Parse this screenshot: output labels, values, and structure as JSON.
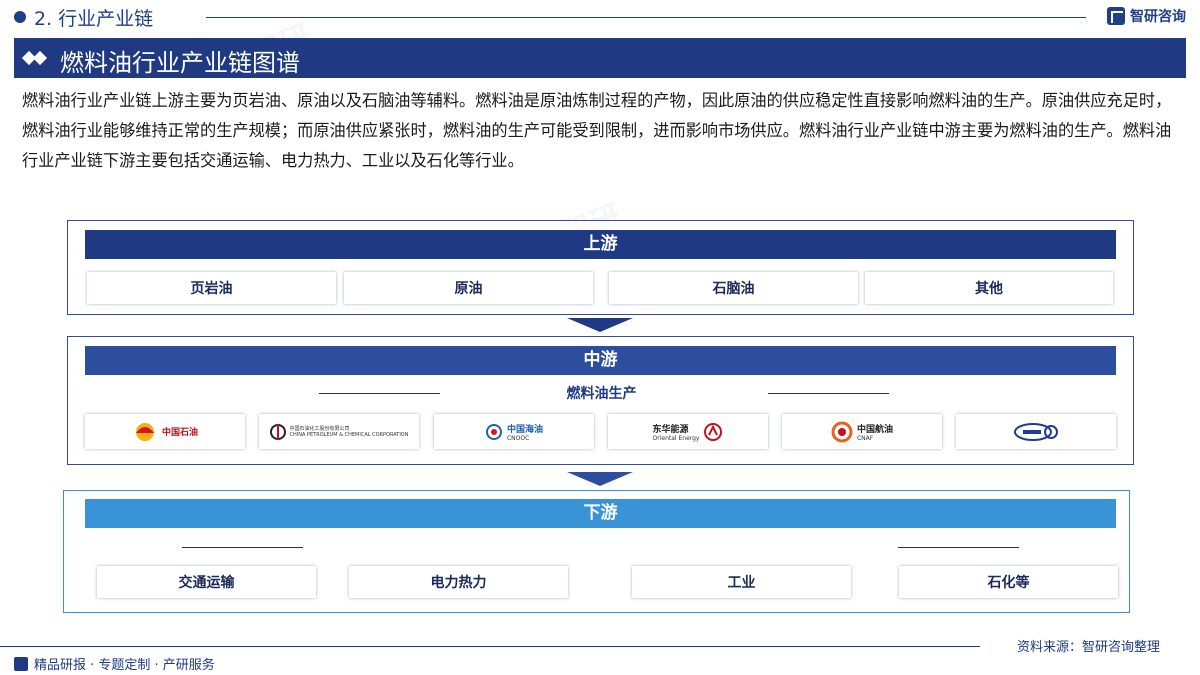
{
  "header": {
    "section_label": "2. 行业产业链",
    "brand_name": "智研咨询"
  },
  "title_bar": {
    "title": "燃料油行业产业链图谱"
  },
  "intro_text": "燃料油行业产业链上游主要为页岩油、原油以及石脑油等辅料。燃料油是原油炼制过程的产物，因此原油的供应稳定性直接影响燃料油的生产。原油供应充足时，燃料油行业能够维持正常的生产规模；而原油供应紧张时，燃料油的生产可能受到限制，进而影响市场供应。燃料油行业产业链中游主要为燃料油的生产。燃料油行业产业链下游主要包括交通运输、电力热力、工业以及石化等行业。",
  "upstream": {
    "label": "上游",
    "items": [
      "页岩油",
      "原油",
      "石脑油",
      "其他"
    ]
  },
  "midstream": {
    "label": "中游",
    "sub_label": "燃料油生产",
    "logos": [
      {
        "name": "中国石油"
      },
      {
        "name": "中国石油化工股份有限公司",
        "sub": "CHINA PETROLEUM & CHEMICAL CORPORATION"
      },
      {
        "name": "中国海油",
        "sub": "CNOOC"
      },
      {
        "name": "东华能源",
        "sub": "Oriental Energy"
      },
      {
        "name": "中国航油",
        "sub": "CNAF"
      },
      {
        "name": ""
      }
    ]
  },
  "downstream": {
    "label": "下游",
    "items": [
      "交通运输",
      "电力热力",
      "工业",
      "石化等"
    ]
  },
  "footer": {
    "source": "资料来源：智研咨询整理",
    "slogan": "精品研报 · 专题定制 · 产研服务"
  },
  "colors": {
    "navy": "#1f3a83",
    "mid_blue": "#2d4e9f",
    "light_blue": "#3a93d6"
  }
}
